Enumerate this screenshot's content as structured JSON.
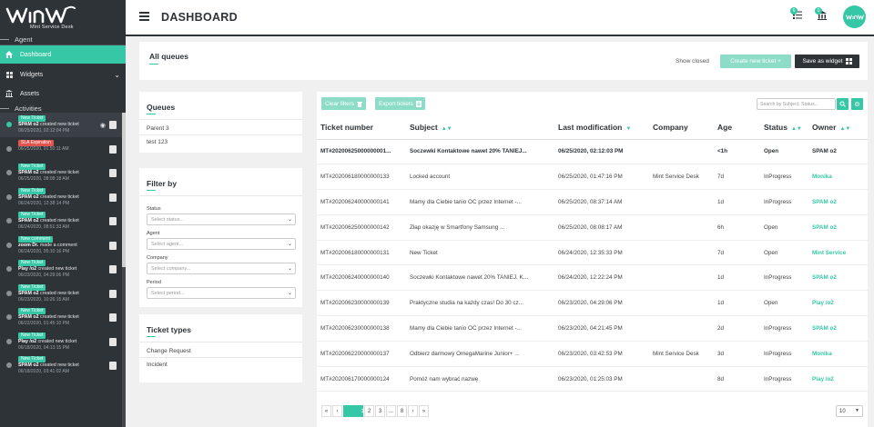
{
  "app": {
    "logo_text": "Mint Service Desk",
    "page_title": "DASHBOARD",
    "accent": "#35c7a6",
    "sidebar_bg": "#2e3338"
  },
  "sidebar": {
    "section_agent": "Agent",
    "items": [
      {
        "label": "Dashboard",
        "icon": "home-icon"
      },
      {
        "label": "Widgets",
        "icon": "grid-icon"
      },
      {
        "label": "Assets",
        "icon": "bank-icon"
      }
    ],
    "section_activities": "Activities",
    "activities": [
      {
        "badge": "New Ticket",
        "badge_color": "green",
        "text_bold": "SPAM o2",
        "text": " created new ticket",
        "date": "06/25/2020, 02:12:04 PM"
      },
      {
        "badge": "SLA Expiration",
        "badge_color": "red",
        "text_bold": "",
        "text": "",
        "date": "06/25/2020, 01:50:11 AM"
      },
      {
        "badge": "New Ticket",
        "badge_color": "green",
        "text_bold": "SPAM o2",
        "text": " created new ticket",
        "date": "06/25/2020, 08:08:18 AM"
      },
      {
        "badge": "New Ticket",
        "badge_color": "green",
        "text_bold": "SPAM o2",
        "text": " created new ticket",
        "date": "06/24/2020, 12:38:14 PM"
      },
      {
        "badge": "New Ticket",
        "badge_color": "green",
        "text_bold": "SPAM o2",
        "text": " created new ticket",
        "date": "06/24/2020, 08:51:33 AM"
      },
      {
        "badge": "New comment",
        "badge_color": "green",
        "text_bold": "zoom Dr.",
        "text": " made a comment",
        "date": "06/24/2020, 05:10:16 PM"
      },
      {
        "badge": "New Ticket",
        "badge_color": "green",
        "text_bold": "Play /o2",
        "text": " created new ticket",
        "date": "06/23/2020, 04:29:06 PM"
      },
      {
        "badge": "New Ticket",
        "badge_color": "green",
        "text_bold": "SPAM o2",
        "text": " created new ticket",
        "date": "06/23/2020, 10:26:15 AM"
      },
      {
        "badge": "New Ticket",
        "badge_color": "green",
        "text_bold": "SPAM o2",
        "text": " created new ticket",
        "date": "06/22/2020, 01:45:10 PM"
      },
      {
        "badge": "New Ticket",
        "badge_color": "green",
        "text_bold": "Play /o2",
        "text": " created new ticket",
        "date": "06/18/2020, 04:13:15 PM"
      },
      {
        "badge": "New Ticket",
        "badge_color": "green",
        "text_bold": "SPAM o2",
        "text": " created new ticket",
        "date": "06/18/2020, 03:41:02 AM"
      }
    ]
  },
  "header": {
    "badge_1": "6",
    "badge_2": "0"
  },
  "all_queues": {
    "title": "All queues",
    "show_closed": "Show closed",
    "create_button": "Create new ticket +",
    "save_widget": "Save as widget"
  },
  "queues": {
    "title": "Queues",
    "items": [
      "Parent 3",
      "test 123"
    ]
  },
  "filter": {
    "title": "Filter by",
    "status_label": "Status",
    "status_placeholder": "Select status...",
    "agent_label": "Agent",
    "agent_placeholder": "Select agent...",
    "company_label": "Company",
    "company_placeholder": "Select company...",
    "period_label": "Period",
    "period_placeholder": "Select period..."
  },
  "ticket_types": {
    "title": "Ticket types",
    "items": [
      "Change Request",
      "Incident"
    ]
  },
  "table": {
    "clear_filters": "Clear filters",
    "export_tickets": "Export tickets",
    "search_placeholder": "Search by Subject, Status...",
    "headers": [
      "Ticket number",
      "Subject",
      "Last modification",
      "Company",
      "Age",
      "Status",
      "Owner"
    ],
    "rows": [
      {
        "num": "MT#20200625000000001...",
        "subject": "Soczewki Kontaktowe nawet 20% TANIEJ...",
        "mod": "06/25/2020, 02:12:03 PM",
        "company": "",
        "age": "<1h",
        "status": "Open",
        "owner": "SPAM o2",
        "bold": true
      },
      {
        "num": "MT#202006180000000133",
        "subject": "Locked account",
        "mod": "06/25/2020, 01:47:16 PM",
        "company": "Mint Service Desk",
        "age": "7d",
        "status": "InProgress",
        "owner": "Monika",
        "bold": false
      },
      {
        "num": "MT#202006240000000141",
        "subject": "Mamy dla Ciebie tanio OC przez Internet -...",
        "mod": "06/25/2020, 08:37:14 AM",
        "company": "",
        "age": "1d",
        "status": "InProgress",
        "owner": "SPAM o2",
        "bold": false
      },
      {
        "num": "MT#202006250000000142",
        "subject": "Złap okazję w        Smartfony Samsung ...",
        "mod": "06/25/2020, 08:08:17 AM",
        "company": "",
        "age": "6h",
        "status": "Open",
        "owner": "SPAM o2",
        "bold": false
      },
      {
        "num": "MT#202006180000000131",
        "subject": "New Ticket",
        "mod": "06/24/2020, 12:35:33 PM",
        "company": "",
        "age": "7d",
        "status": "Open",
        "owner": "Mint Service",
        "bold": false
      },
      {
        "num": "MT#202006240000000140",
        "subject": "Soczewki Kontaktowe nawet 20% TANIEJ. K...",
        "mod": "06/24/2020, 12:22:24 PM",
        "company": "",
        "age": "1d",
        "status": "InProgress",
        "owner": "SPAM o2",
        "bold": false
      },
      {
        "num": "MT#202006230000000139",
        "subject": "Praktyczne studia na każdy czas! Do 30 cz...",
        "mod": "06/23/2020, 04:29:06 PM",
        "company": "",
        "age": "1d",
        "status": "Open",
        "owner": "Play /o2",
        "bold": false
      },
      {
        "num": "MT#202006230000000138",
        "subject": "Mamy dla Ciebie tanio OC przez Internet -...",
        "mod": "06/23/2020, 04:21:45 PM",
        "company": "",
        "age": "2d",
        "status": "InProgress",
        "owner": "SPAM o2",
        "bold": false
      },
      {
        "num": "MT#202006220000000137",
        "subject": "Odbierz darmowy OmegaMarine Junior+ ...",
        "mod": "06/23/2020, 03:42:53 PM",
        "company": "Mint Service Desk",
        "age": "3d",
        "status": "InProgress",
        "owner": "Monika",
        "bold": false
      },
      {
        "num": "MT#202006170000000124",
        "subject": "Pomóż nam wybrać nazwę",
        "mod": "06/23/2020, 01:25:03 PM",
        "company": "",
        "age": "8d",
        "status": "InProgress",
        "owner": "Play /o2",
        "bold": false
      }
    ],
    "pager": [
      "«",
      "‹",
      "1",
      "2",
      "3",
      "...",
      "8",
      "›",
      "»"
    ],
    "active_page": "1",
    "per_page": "10"
  }
}
